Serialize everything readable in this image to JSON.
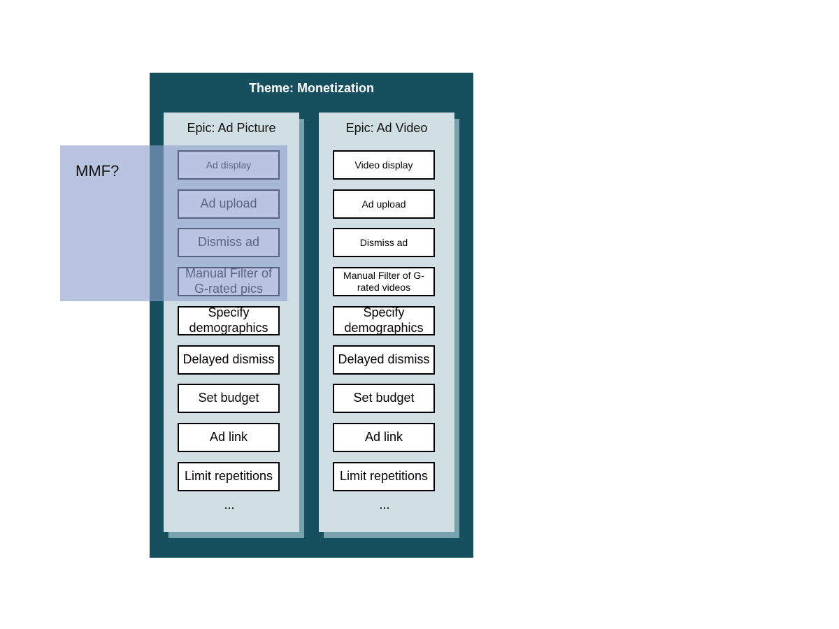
{
  "theme": {
    "title": "Theme: Monetization",
    "color": "#16505e"
  },
  "epics": [
    {
      "title": "Epic: Ad Picture",
      "stories": [
        {
          "label": "Ad display",
          "size": "small"
        },
        {
          "label": "Ad upload",
          "size": "large"
        },
        {
          "label": "Dismiss ad",
          "size": "large"
        },
        {
          "label": "Manual Filter of G-rated pics",
          "size": "large"
        },
        {
          "label": "Specify demographics",
          "size": "large"
        },
        {
          "label": "Delayed dismiss",
          "size": "large"
        },
        {
          "label": "Set budget",
          "size": "large"
        },
        {
          "label": "Ad link",
          "size": "large"
        },
        {
          "label": "Limit repetitions",
          "size": "large"
        }
      ],
      "more": "..."
    },
    {
      "title": "Epic: Ad Video",
      "stories": [
        {
          "label": "Video display",
          "size": "small"
        },
        {
          "label": "Ad upload",
          "size": "small"
        },
        {
          "label": "Dismiss ad",
          "size": "small"
        },
        {
          "label": "Manual Filter of G-rated videos",
          "size": "small"
        },
        {
          "label": "Specify demographics",
          "size": "large"
        },
        {
          "label": "Delayed dismiss",
          "size": "large"
        },
        {
          "label": "Set budget",
          "size": "large"
        },
        {
          "label": "Ad link",
          "size": "large"
        },
        {
          "label": "Limit repetitions",
          "size": "large"
        }
      ],
      "more": "..."
    }
  ],
  "mmf": {
    "label": "MMF?"
  }
}
